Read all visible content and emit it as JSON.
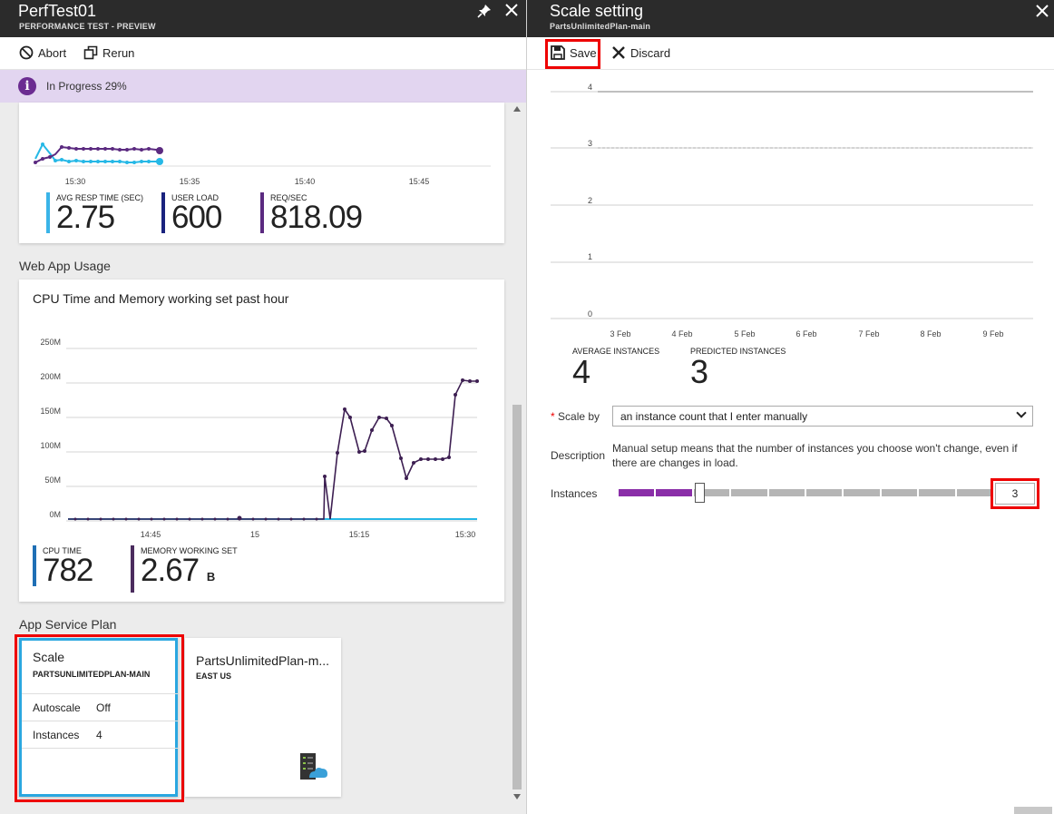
{
  "left": {
    "title": "PerfTest01",
    "subtitle": "PERFORMANCE TEST - PREVIEW",
    "toolbar": {
      "abort": "Abort",
      "rerun": "Rerun"
    },
    "status": "In Progress 29%",
    "perf_chart": {
      "x_ticks": [
        "15:30",
        "15:35",
        "15:40",
        "15:45"
      ],
      "kpis": [
        {
          "label": "AVG RESP TIME (SEC)",
          "value": "2.75",
          "color": "#3ab4e8"
        },
        {
          "label": "USER LOAD",
          "value": "600",
          "color": "#1a237e"
        },
        {
          "label": "REQ/SEC",
          "value": "818.09",
          "color": "#5b2a80"
        }
      ]
    },
    "web_app_usage_label": "Web App Usage",
    "usage_chart": {
      "title": "CPU Time and Memory working set past hour",
      "y_ticks": [
        "250M",
        "200M",
        "150M",
        "100M",
        "50M",
        "0M"
      ],
      "x_ticks": [
        "14:45",
        "15",
        "15:15",
        "15:30"
      ],
      "kpis": [
        {
          "label": "CPU TIME",
          "value": "782",
          "unit": "",
          "color": "#1f6fb5"
        },
        {
          "label": "MEMORY WORKING SET",
          "value": "2.67",
          "unit": "B",
          "color": "#4b2c5e"
        }
      ]
    },
    "app_service_plan_label": "App Service Plan",
    "scale_tile": {
      "title": "Scale",
      "subtitle": "PARTSUNLIMITEDPLAN-MAIN",
      "rows": [
        {
          "label": "Autoscale",
          "value": "Off"
        },
        {
          "label": "Instances",
          "value": "4"
        }
      ]
    },
    "plan_tile": {
      "title": "PartsUnlimitedPlan-m...",
      "subtitle": "EAST US"
    }
  },
  "right": {
    "title": "Scale setting",
    "subtitle": "PartsUnlimitedPlan-main",
    "toolbar": {
      "save": "Save",
      "discard": "Discard"
    },
    "instance_chart": {
      "y_ticks": [
        "4",
        "3",
        "2",
        "1",
        "0"
      ],
      "x_ticks": [
        "3 Feb",
        "4 Feb",
        "5 Feb",
        "6 Feb",
        "7 Feb",
        "8 Feb",
        "9 Feb"
      ]
    },
    "stats": [
      {
        "label": "AVERAGE INSTANCES",
        "value": "4"
      },
      {
        "label": "PREDICTED INSTANCES",
        "value": "3"
      }
    ],
    "scale_by": {
      "required_mark": "*",
      "label": "Scale by",
      "value": "an instance count that I enter manually"
    },
    "description": {
      "label": "Description",
      "text": "Manual setup means that the number of instances you choose won't change, even if there are changes in load."
    },
    "instances": {
      "label": "Instances",
      "value": "3",
      "segments": 10,
      "slider_value": 3,
      "accent": "#8a2ea8"
    }
  }
}
